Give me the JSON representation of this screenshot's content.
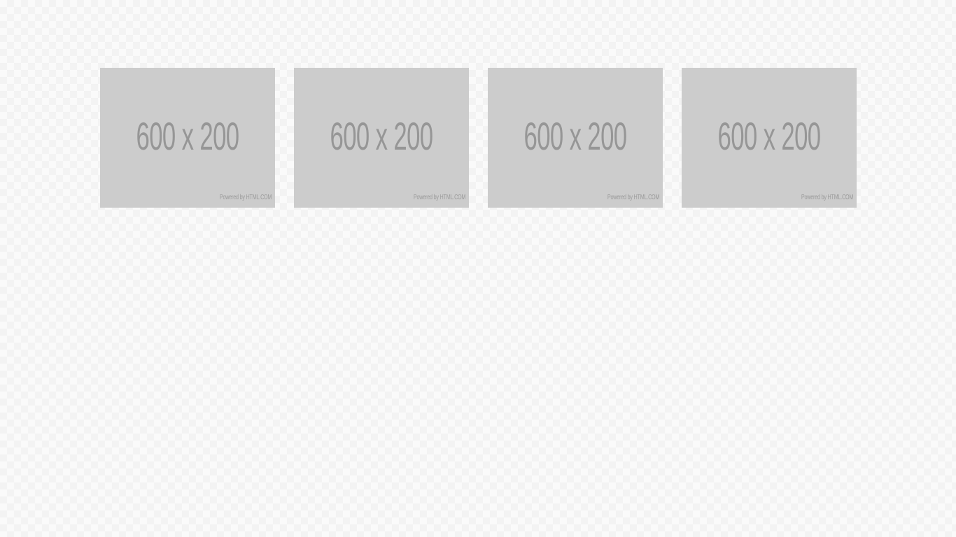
{
  "placeholders": [
    {
      "label": "600 x 200",
      "credit": "Powered by HTML.COM"
    },
    {
      "label": "600 x 200",
      "credit": "Powered by HTML.COM"
    },
    {
      "label": "600 x 200",
      "credit": "Powered by HTML.COM"
    },
    {
      "label": "600 x 200",
      "credit": "Powered by HTML.COM"
    }
  ],
  "colors": {
    "placeholder_bg": "#cccccc",
    "placeholder_text": "#969696",
    "page_bg": "#fafafa"
  }
}
